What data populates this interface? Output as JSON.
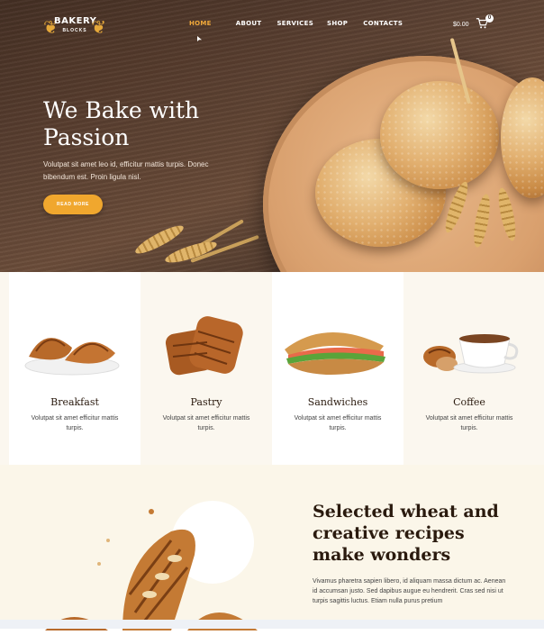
{
  "nav": {
    "brand": "BAKERY",
    "brand_sub": "BLOCKS",
    "menu": [
      "HOME",
      "ABOUT",
      "SERVICES",
      "SHOP",
      "CONTACTS"
    ],
    "cart_total": "$0.00",
    "cart_count": "0"
  },
  "hero": {
    "title": "We Bake with Passion",
    "text": "Volutpat sit amet leo id, efficitur mattis turpis. Donec bibendum est. Proin ligula nisl.",
    "button": "READ MORE"
  },
  "categories": [
    {
      "name": "Breakfast",
      "desc": "Volutpat sit amet efficitur mattis turpis."
    },
    {
      "name": "Pastry",
      "desc": "Volutpat sit amet efficitur mattis turpis."
    },
    {
      "name": "Sandwiches",
      "desc": "Volutpat sit amet efficitur mattis turpis."
    },
    {
      "name": "Coffee",
      "desc": "Volutpat sit amet efficitur mattis turpis."
    }
  ],
  "feature": {
    "title": "Selected wheat and creative recipes make wonders",
    "text": "Vivamus pharetra sapien libero, id aliquam massa dictum ac. Aenean id accumsan justo. Sed dapibus augue eu hendrerit. Cras sed nisi ut turpis sagittis luctus. Etiam nulla purus pretium"
  },
  "colors": {
    "accent": "#f0a72e",
    "dark": "#2a1a0e",
    "cream": "#fbf7ef"
  }
}
